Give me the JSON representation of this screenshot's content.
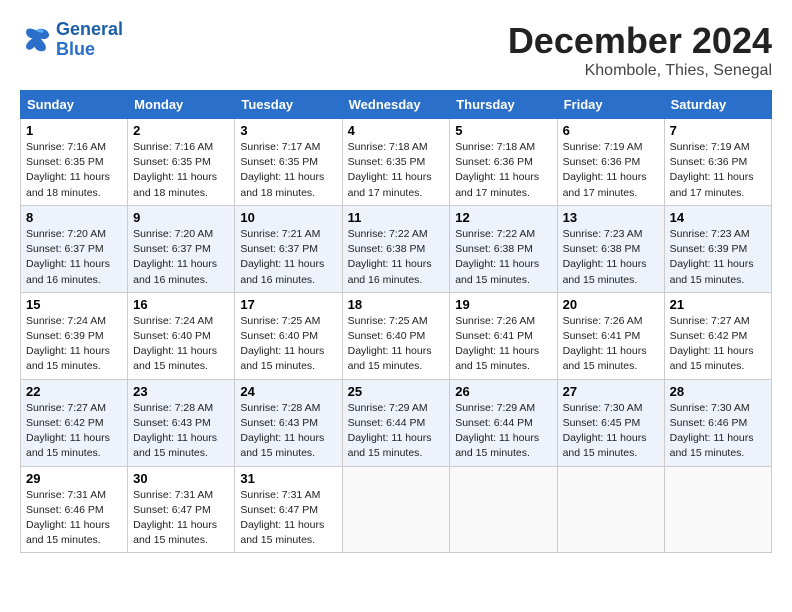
{
  "header": {
    "logo_line1": "General",
    "logo_line2": "Blue",
    "month": "December 2024",
    "location": "Khombole, Thies, Senegal"
  },
  "weekdays": [
    "Sunday",
    "Monday",
    "Tuesday",
    "Wednesday",
    "Thursday",
    "Friday",
    "Saturday"
  ],
  "weeks": [
    [
      {
        "day": "1",
        "sunrise": "7:16 AM",
        "sunset": "6:35 PM",
        "daylight": "11 hours and 18 minutes."
      },
      {
        "day": "2",
        "sunrise": "7:16 AM",
        "sunset": "6:35 PM",
        "daylight": "11 hours and 18 minutes."
      },
      {
        "day": "3",
        "sunrise": "7:17 AM",
        "sunset": "6:35 PM",
        "daylight": "11 hours and 18 minutes."
      },
      {
        "day": "4",
        "sunrise": "7:18 AM",
        "sunset": "6:35 PM",
        "daylight": "11 hours and 17 minutes."
      },
      {
        "day": "5",
        "sunrise": "7:18 AM",
        "sunset": "6:36 PM",
        "daylight": "11 hours and 17 minutes."
      },
      {
        "day": "6",
        "sunrise": "7:19 AM",
        "sunset": "6:36 PM",
        "daylight": "11 hours and 17 minutes."
      },
      {
        "day": "7",
        "sunrise": "7:19 AM",
        "sunset": "6:36 PM",
        "daylight": "11 hours and 17 minutes."
      }
    ],
    [
      {
        "day": "8",
        "sunrise": "7:20 AM",
        "sunset": "6:37 PM",
        "daylight": "11 hours and 16 minutes."
      },
      {
        "day": "9",
        "sunrise": "7:20 AM",
        "sunset": "6:37 PM",
        "daylight": "11 hours and 16 minutes."
      },
      {
        "day": "10",
        "sunrise": "7:21 AM",
        "sunset": "6:37 PM",
        "daylight": "11 hours and 16 minutes."
      },
      {
        "day": "11",
        "sunrise": "7:22 AM",
        "sunset": "6:38 PM",
        "daylight": "11 hours and 16 minutes."
      },
      {
        "day": "12",
        "sunrise": "7:22 AM",
        "sunset": "6:38 PM",
        "daylight": "11 hours and 15 minutes."
      },
      {
        "day": "13",
        "sunrise": "7:23 AM",
        "sunset": "6:38 PM",
        "daylight": "11 hours and 15 minutes."
      },
      {
        "day": "14",
        "sunrise": "7:23 AM",
        "sunset": "6:39 PM",
        "daylight": "11 hours and 15 minutes."
      }
    ],
    [
      {
        "day": "15",
        "sunrise": "7:24 AM",
        "sunset": "6:39 PM",
        "daylight": "11 hours and 15 minutes."
      },
      {
        "day": "16",
        "sunrise": "7:24 AM",
        "sunset": "6:40 PM",
        "daylight": "11 hours and 15 minutes."
      },
      {
        "day": "17",
        "sunrise": "7:25 AM",
        "sunset": "6:40 PM",
        "daylight": "11 hours and 15 minutes."
      },
      {
        "day": "18",
        "sunrise": "7:25 AM",
        "sunset": "6:40 PM",
        "daylight": "11 hours and 15 minutes."
      },
      {
        "day": "19",
        "sunrise": "7:26 AM",
        "sunset": "6:41 PM",
        "daylight": "11 hours and 15 minutes."
      },
      {
        "day": "20",
        "sunrise": "7:26 AM",
        "sunset": "6:41 PM",
        "daylight": "11 hours and 15 minutes."
      },
      {
        "day": "21",
        "sunrise": "7:27 AM",
        "sunset": "6:42 PM",
        "daylight": "11 hours and 15 minutes."
      }
    ],
    [
      {
        "day": "22",
        "sunrise": "7:27 AM",
        "sunset": "6:42 PM",
        "daylight": "11 hours and 15 minutes."
      },
      {
        "day": "23",
        "sunrise": "7:28 AM",
        "sunset": "6:43 PM",
        "daylight": "11 hours and 15 minutes."
      },
      {
        "day": "24",
        "sunrise": "7:28 AM",
        "sunset": "6:43 PM",
        "daylight": "11 hours and 15 minutes."
      },
      {
        "day": "25",
        "sunrise": "7:29 AM",
        "sunset": "6:44 PM",
        "daylight": "11 hours and 15 minutes."
      },
      {
        "day": "26",
        "sunrise": "7:29 AM",
        "sunset": "6:44 PM",
        "daylight": "11 hours and 15 minutes."
      },
      {
        "day": "27",
        "sunrise": "7:30 AM",
        "sunset": "6:45 PM",
        "daylight": "11 hours and 15 minutes."
      },
      {
        "day": "28",
        "sunrise": "7:30 AM",
        "sunset": "6:46 PM",
        "daylight": "11 hours and 15 minutes."
      }
    ],
    [
      {
        "day": "29",
        "sunrise": "7:31 AM",
        "sunset": "6:46 PM",
        "daylight": "11 hours and 15 minutes."
      },
      {
        "day": "30",
        "sunrise": "7:31 AM",
        "sunset": "6:47 PM",
        "daylight": "11 hours and 15 minutes."
      },
      {
        "day": "31",
        "sunrise": "7:31 AM",
        "sunset": "6:47 PM",
        "daylight": "11 hours and 15 minutes."
      },
      null,
      null,
      null,
      null
    ]
  ]
}
